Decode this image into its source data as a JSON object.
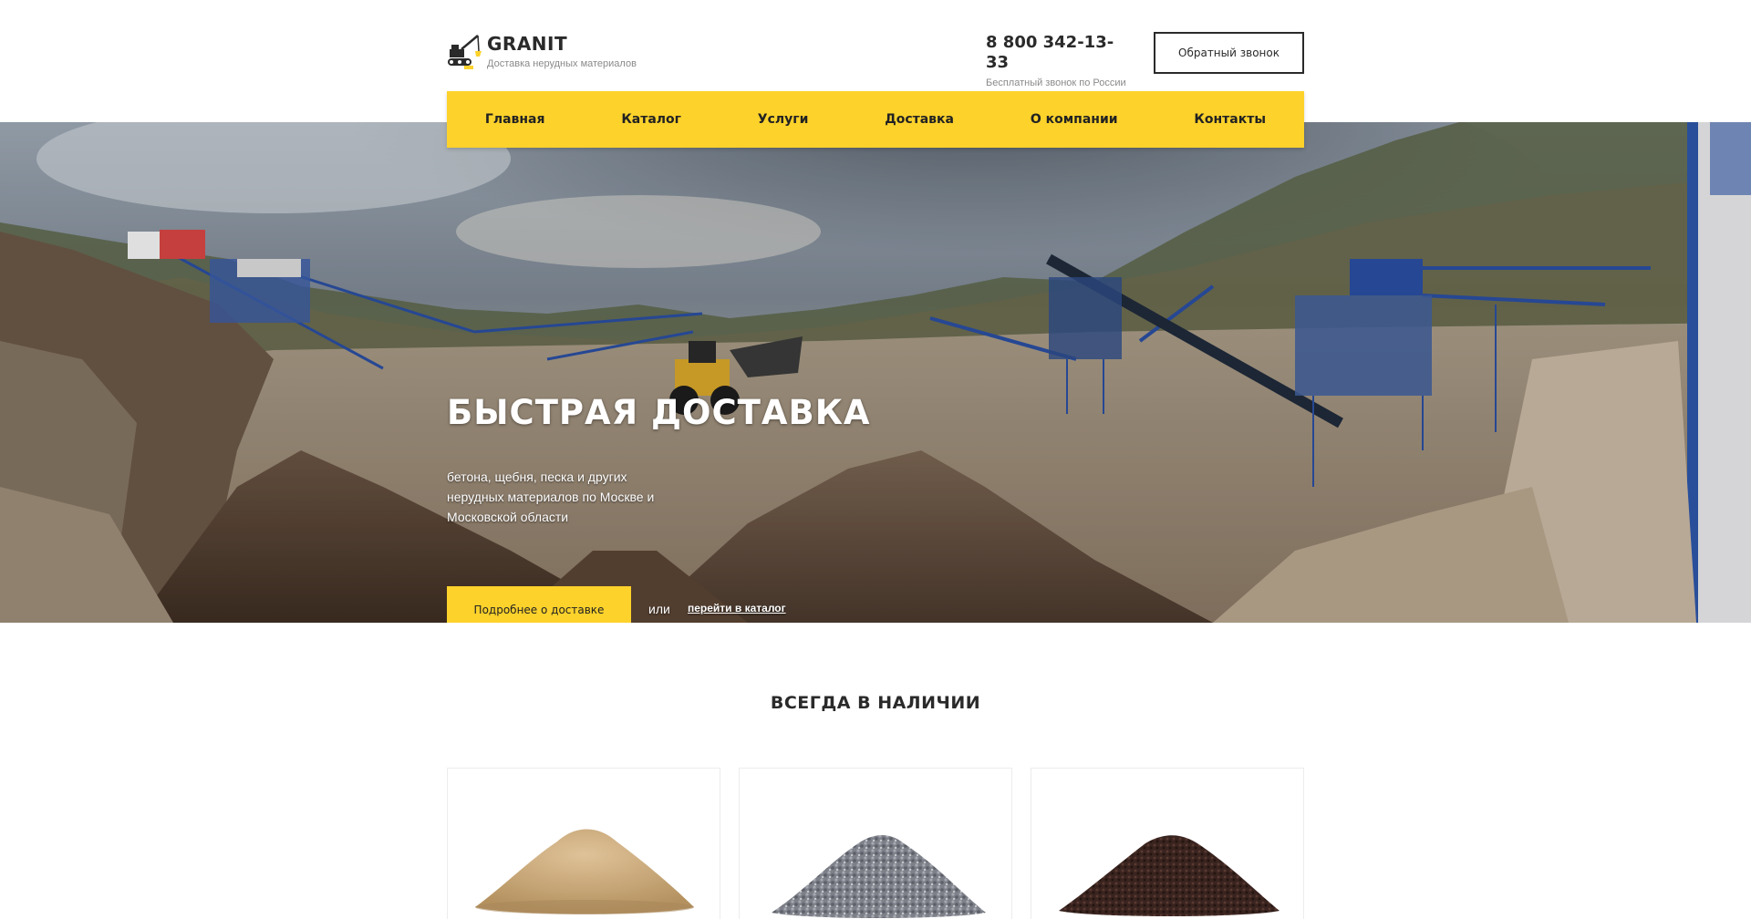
{
  "header": {
    "brand": "GRANIT",
    "tagline": "Доставка нерудных материалов",
    "phone": "8 800 342-13-33",
    "phone_note": "Бесплатный звонок по России",
    "callback_label": "Обратный звонок"
  },
  "nav": {
    "items": [
      {
        "label": "Главная"
      },
      {
        "label": "Каталог"
      },
      {
        "label": "Услуги"
      },
      {
        "label": "Доставка"
      },
      {
        "label": "О компании"
      },
      {
        "label": "Контакты"
      }
    ]
  },
  "hero": {
    "title": "БЫСТРАЯ ДОСТАВКА",
    "text": "бетона, щебня, песка и других нерудных материалов по Москве и Московской области",
    "button_label": "Подробнее о доставке",
    "or_text": "или",
    "link_label": "перейти в каталог"
  },
  "stock": {
    "title": "ВСЕГДА В НАЛИЧИИ",
    "items": [
      {
        "image": "sand-pile",
        "color": "#c9a77a"
      },
      {
        "image": "gravel-pile",
        "color": "#7d8088"
      },
      {
        "image": "soil-pile",
        "color": "#3a2420"
      }
    ]
  },
  "colors": {
    "accent": "#fdd22b",
    "text": "#2a2a2a",
    "muted": "#8a8a8a"
  }
}
